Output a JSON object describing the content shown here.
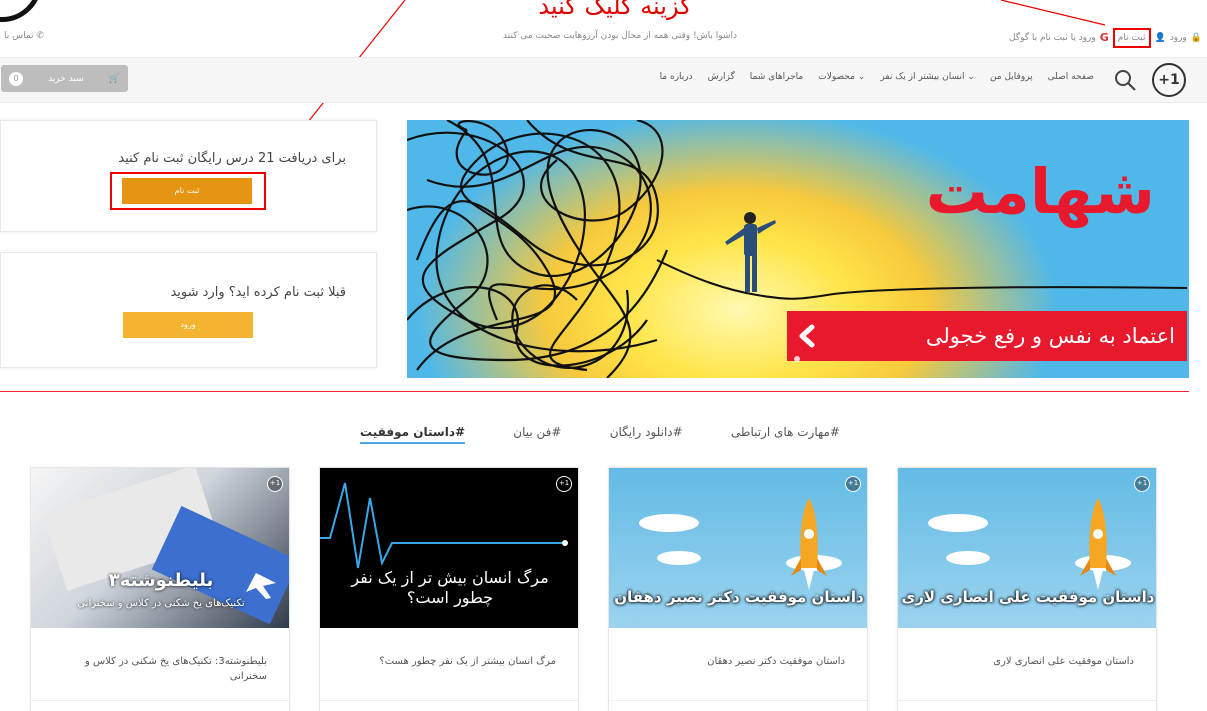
{
  "annotation": {
    "label": "گزینه کلیک کنید"
  },
  "topbar": {
    "contact": "تماس با",
    "tagline": "داشوا باش! وقتی همه از محال بودن آرزوهایت صحبت می کنند",
    "login": "ورود",
    "register": "ثبت نام",
    "google_login": "ورود یا ثبت نام با گوگل"
  },
  "nav": {
    "logo": "+1",
    "items": [
      {
        "label": "صفحه اصلی"
      },
      {
        "label": "پروفایل من"
      },
      {
        "label": "انسان بیشتر از یک نفر ⌄"
      },
      {
        "label": "محصولات ⌄"
      },
      {
        "label": "ماجراهای شما"
      },
      {
        "label": "گزارش"
      },
      {
        "label": "درباره ما"
      }
    ],
    "cart_label": "سبد خرید",
    "cart_count": "0"
  },
  "register_panel": {
    "title": "برای دریافت 21 درس رایگان ثبت نام کنید",
    "button": "ثبت نام"
  },
  "login_panel": {
    "title": "قبلا ثبت نام کرده اید؟ وارد شوید",
    "button": "ورود"
  },
  "banner": {
    "title": "شهامت",
    "subtitle": "اعتماد به نفس و رفع خجولی"
  },
  "tabs": [
    "#داستان موفقیت",
    "#فن بیان",
    "#دانلود رایگان",
    "#مهارت های ارتباطی"
  ],
  "cards": [
    {
      "thumb_text": "داستان موفقیت علی انصاری لاری",
      "title": "داستان موفقیت علی انصاری لاری",
      "meta": "..."
    },
    {
      "thumb_text": "داستان موفقیت دکتر نصیر دهقان",
      "title": "داستان موفقیت دکتر نصیر دهقان",
      "meta": "..."
    },
    {
      "thumb_text": "مرگ انسان بیش تر از یک نفر چطور است؟",
      "title": "مرگ انسان بیشتر از یک نفر چطور هست؟",
      "meta": "..."
    },
    {
      "thumb_text": "بلیطنوشته۳",
      "thumb_sub": "تکنیک‌های یخ شکنی در کلاس و سخنرانی",
      "title": "بلیطنوشته3: تکنیک‌های یخ شکنی در کلاس و سخنرانی",
      "meta": "..."
    }
  ],
  "colors": {
    "accent_red": "#e8192c",
    "button_orange": "#e69512",
    "button_yellow": "#f3b432",
    "tab_underline": "#4aa7e6"
  }
}
